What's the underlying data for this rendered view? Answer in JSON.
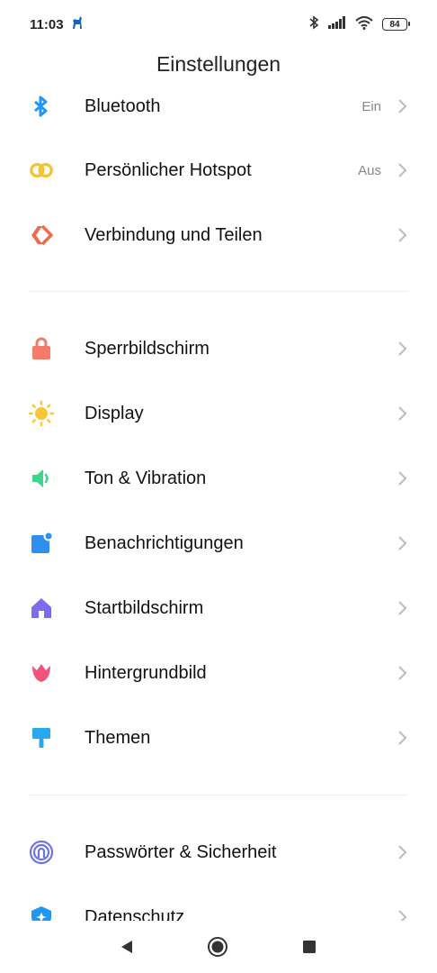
{
  "status_bar": {
    "time": "11:03",
    "battery": "84",
    "icons": [
      "app-notification-icon",
      "bluetooth-icon",
      "signal-icon",
      "wifi-icon",
      "battery-icon"
    ]
  },
  "header": {
    "title": "Einstellungen"
  },
  "sections": [
    {
      "items": [
        {
          "label": "Bluetooth",
          "value": "Ein",
          "icon": "bluetooth-icon",
          "color": "#2196F3"
        },
        {
          "label": "Persönlicher Hotspot",
          "value": "Aus",
          "icon": "hotspot-icon",
          "color": "#F4C430"
        },
        {
          "label": "Verbindung und Teilen",
          "value": "",
          "icon": "connection-sharing-icon",
          "color": "#F06A50"
        }
      ]
    },
    {
      "items": [
        {
          "label": "Sperrbildschirm",
          "icon": "lock-icon",
          "color": "#F37B6A"
        },
        {
          "label": "Display",
          "icon": "sun-icon",
          "color": "#F8C537"
        },
        {
          "label": "Ton & Vibration",
          "icon": "speaker-icon",
          "color": "#3DD68C"
        },
        {
          "label": "Benachrichtigungen",
          "icon": "notification-icon",
          "color": "#2F8FF0"
        },
        {
          "label": "Startbildschirm",
          "icon": "home-icon",
          "color": "#7B6CF0"
        },
        {
          "label": "Hintergrundbild",
          "icon": "tulip-icon",
          "color": "#F0567A"
        },
        {
          "label": "Themen",
          "icon": "paintbrush-icon",
          "color": "#29A8F0"
        }
      ]
    },
    {
      "items": [
        {
          "label": "Passwörter & Sicherheit",
          "icon": "fingerprint-icon",
          "color": "#6B73E8"
        },
        {
          "label": "Datenschutz",
          "icon": "privacy-shield-icon",
          "color": "#2196F3"
        }
      ]
    }
  ],
  "nav_bar": {
    "buttons": [
      "back-icon",
      "home-circle-icon",
      "recents-square-icon"
    ]
  }
}
